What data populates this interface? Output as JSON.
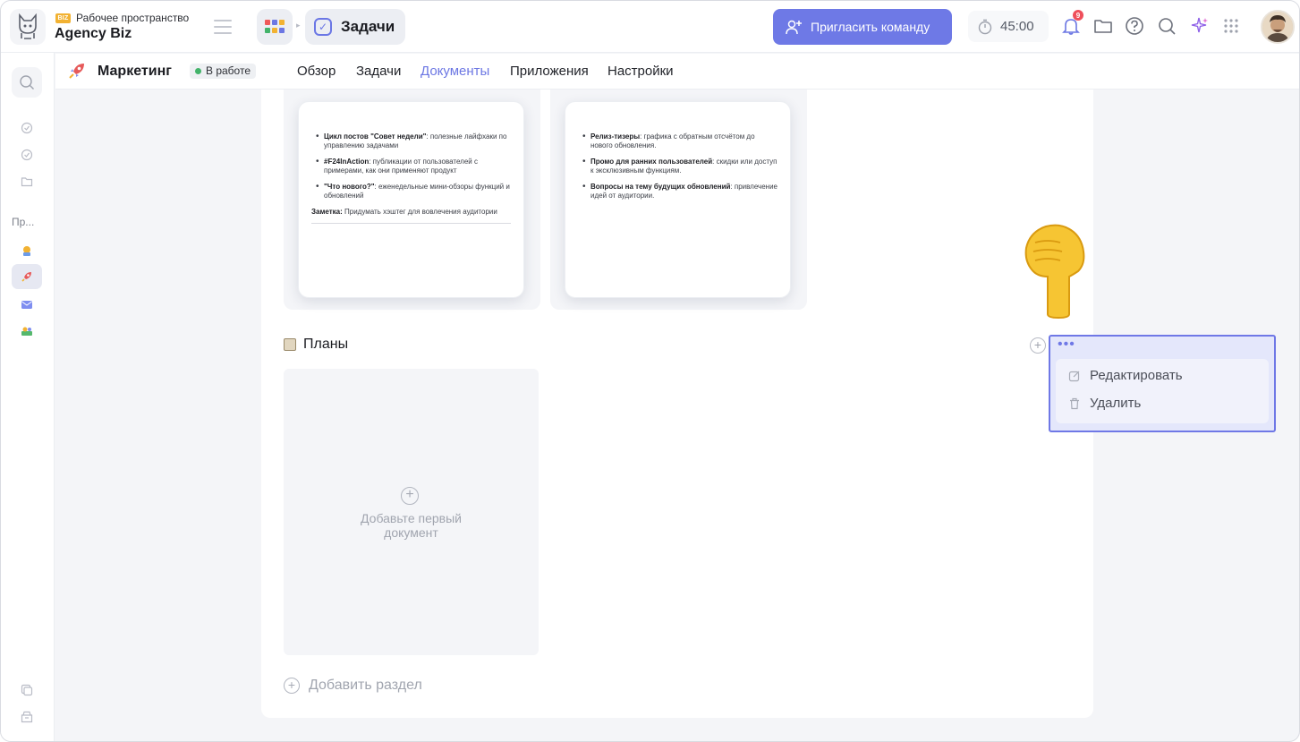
{
  "workspace": {
    "badge": "BIZ",
    "label": "Рабочее пространство",
    "name": "Agency Biz"
  },
  "breadcrumb": {
    "current": "Задачи"
  },
  "header": {
    "invite_label": "Пригласить команду",
    "timer": "45:00",
    "notifications_count": "9"
  },
  "rail": {
    "section_label": "Пр..."
  },
  "project": {
    "title": "Маркетинг",
    "status": "В работе",
    "tabs": [
      {
        "label": "Обзор",
        "active": false
      },
      {
        "label": "Задачи",
        "active": false
      },
      {
        "label": "Документы",
        "active": true
      },
      {
        "label": "Приложения",
        "active": false
      },
      {
        "label": "Настройки",
        "active": false
      }
    ]
  },
  "documents": [
    {
      "items": [
        {
          "bold": "Цикл постов \"Совет недели\"",
          "text": ": полезные лайфхаки по управлению задачами"
        },
        {
          "bold": "#F24InAction",
          "text": ": публикации от пользователей с примерами, как они применяют продукт"
        },
        {
          "bold": "\"Что нового?\"",
          "text": ": еженедельные мини-обзоры функций и обновлений"
        }
      ],
      "note_bold": "Заметка:",
      "note_text": " Придумать хэштег для вовлечения аудитории"
    },
    {
      "items": [
        {
          "bold": "Релиз-тизеры",
          "text": ": графика с обратным отсчётом до нового обновления."
        },
        {
          "bold": "Промо для ранних пользователей",
          "text": ": скидки или доступ к эксклюзивным функциям."
        },
        {
          "bold": "Вопросы на тему будущих обновлений",
          "text": ": привлечение идей от аудитории."
        }
      ]
    }
  ],
  "plans_section": {
    "title": "Планы",
    "empty_text_line1": "Добавьте первый",
    "empty_text_line2": "документ"
  },
  "add_section_label": "Добавить раздел",
  "context_menu": {
    "edit_label": "Редактировать",
    "delete_label": "Удалить"
  },
  "colors": {
    "accent": "#6e79e6",
    "status_green": "#43b36a",
    "notification": "#ef4f5b"
  }
}
